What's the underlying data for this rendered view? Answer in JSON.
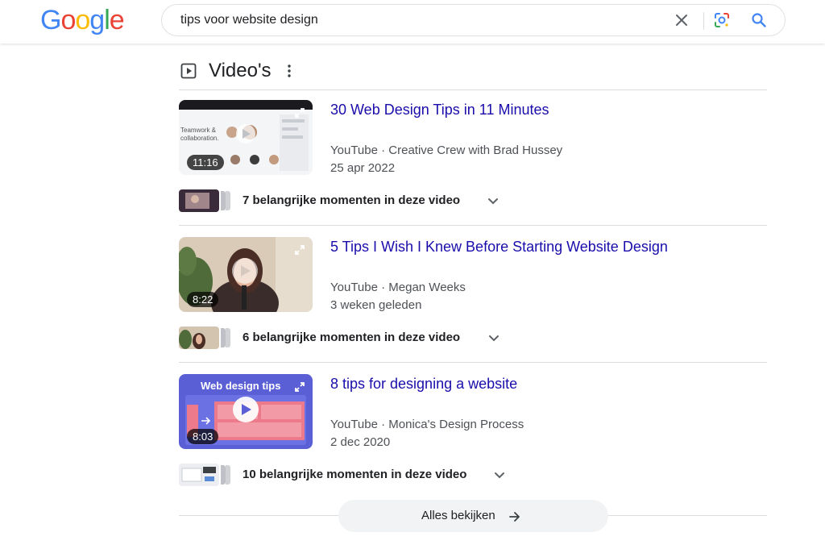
{
  "header": {
    "logo": "Google",
    "search_query": "tips voor website design"
  },
  "section": {
    "title": "Video's"
  },
  "videos": [
    {
      "title": "30 Web Design Tips in 11 Minutes",
      "source": "YouTube · Creative Crew with Brad Hussey",
      "date": "25 apr 2022",
      "duration": "11:16",
      "moments": "7 belangrijke momenten in deze video"
    },
    {
      "title": "5 Tips I Wish I Knew Before Starting Website Design",
      "source": "YouTube · Megan Weeks",
      "date": "3 weken geleden",
      "duration": "8:22",
      "moments": "6 belangrijke momenten in deze video"
    },
    {
      "title": "8 tips for designing a website",
      "source": "YouTube · Monica's Design Process",
      "date": "2 dec 2020",
      "duration": "8:03",
      "moments": "10 belangrijke momenten in deze video",
      "thumb_text": "Web design tips"
    }
  ],
  "footer": {
    "view_all_label": "Alles bekijken"
  },
  "colors": {
    "link": "#1a0dab",
    "secondary_text": "#4d5156",
    "google_blue": "#4285F4",
    "google_red": "#EA4335",
    "google_yellow": "#FBBC05",
    "google_green": "#34A853"
  }
}
